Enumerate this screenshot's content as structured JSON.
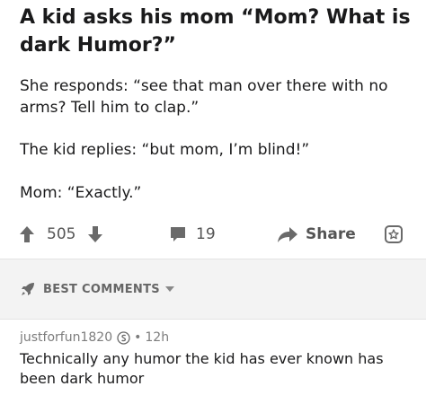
{
  "post": {
    "title": "A kid asks his mom “Mom? What is dark Humor?”",
    "paragraphs": [
      "She responds: “see that man over there with no arms? Tell him to clap.”",
      "The kid replies: “but mom, I’m blind!”",
      "Mom: “Exactly.”"
    ]
  },
  "actions": {
    "upvote_icon": "arrow-up-icon",
    "score": "505",
    "downvote_icon": "arrow-down-icon",
    "comment_icon": "comment-icon",
    "comments": "19",
    "share_icon": "share-arrow-icon",
    "share_label": "Share",
    "award_icon": "award-icon"
  },
  "comments_header": {
    "icon": "rocket-icon",
    "label": "BEST COMMENTS",
    "caret_icon": "caret-down-icon"
  },
  "comment": {
    "author": "justforfun1820",
    "badge_icon": "coin-icon",
    "separator": "•",
    "age": "12h",
    "body": "Technically any humor the kid has ever known has been dark humor"
  },
  "colors": {
    "text": "#1a1a1b",
    "muted": "#7c7c7c",
    "band_bg": "#f3f3f3"
  }
}
